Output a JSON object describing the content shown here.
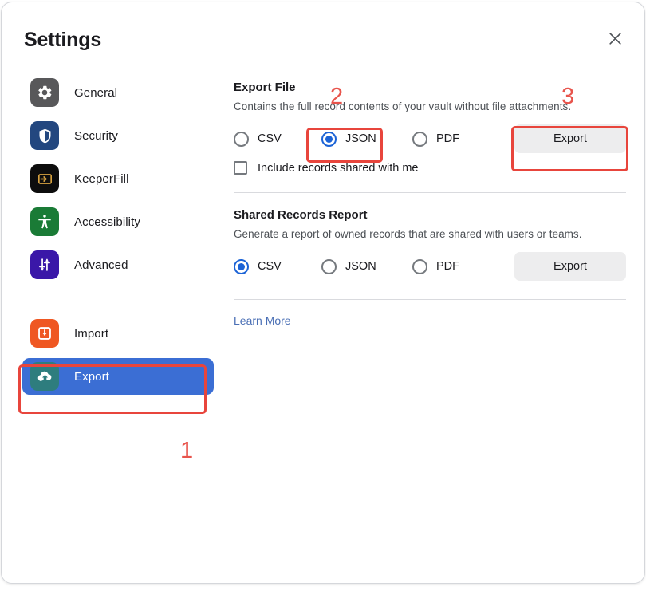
{
  "dialog": {
    "title": "Settings",
    "close_icon": "close-icon"
  },
  "sidebar": {
    "items": [
      {
        "label": "General",
        "icon": "gear-icon",
        "icon_bg": "#58585a",
        "selected": false
      },
      {
        "label": "Security",
        "icon": "shield-icon",
        "icon_bg": "#23477f",
        "selected": false
      },
      {
        "label": "KeeperFill",
        "icon": "login-arrow-icon",
        "icon_bg": "#0d0d0d",
        "selected": false
      },
      {
        "label": "Accessibility",
        "icon": "accessibility-icon",
        "icon_bg": "#1a7b36",
        "selected": false
      },
      {
        "label": "Advanced",
        "icon": "sliders-icon",
        "icon_bg": "#3a17a8",
        "selected": false
      }
    ],
    "items_secondary": [
      {
        "label": "Import",
        "icon": "import-download-icon",
        "icon_bg": "#ef5722",
        "selected": false
      },
      {
        "label": "Export",
        "icon": "cloud-upload-icon",
        "icon_bg": "#2e7d7e",
        "selected": true
      }
    ],
    "selected_bg": "#3b6ed4"
  },
  "export_file": {
    "title": "Export File",
    "description": "Contains the full record contents of your vault without file attachments.",
    "options": [
      {
        "label": "CSV",
        "selected": false
      },
      {
        "label": "JSON",
        "selected": true
      },
      {
        "label": "PDF",
        "selected": false
      }
    ],
    "checkbox": {
      "label": "Include records shared with me",
      "checked": false
    },
    "export_button": "Export"
  },
  "shared_records_report": {
    "title": "Shared Records Report",
    "description": "Generate a report of owned records that are shared with users or teams.",
    "options": [
      {
        "label": "CSV",
        "selected": true
      },
      {
        "label": "JSON",
        "selected": false
      },
      {
        "label": "PDF",
        "selected": false
      }
    ],
    "export_button": "Export"
  },
  "learn_more": "Learn More",
  "annotations": {
    "color": "#e8453c",
    "markers": [
      {
        "number": "1",
        "target": "sidebar-item-export"
      },
      {
        "number": "2",
        "target": "export-file-json-radio"
      },
      {
        "number": "3",
        "target": "export-file-export-button"
      }
    ]
  }
}
